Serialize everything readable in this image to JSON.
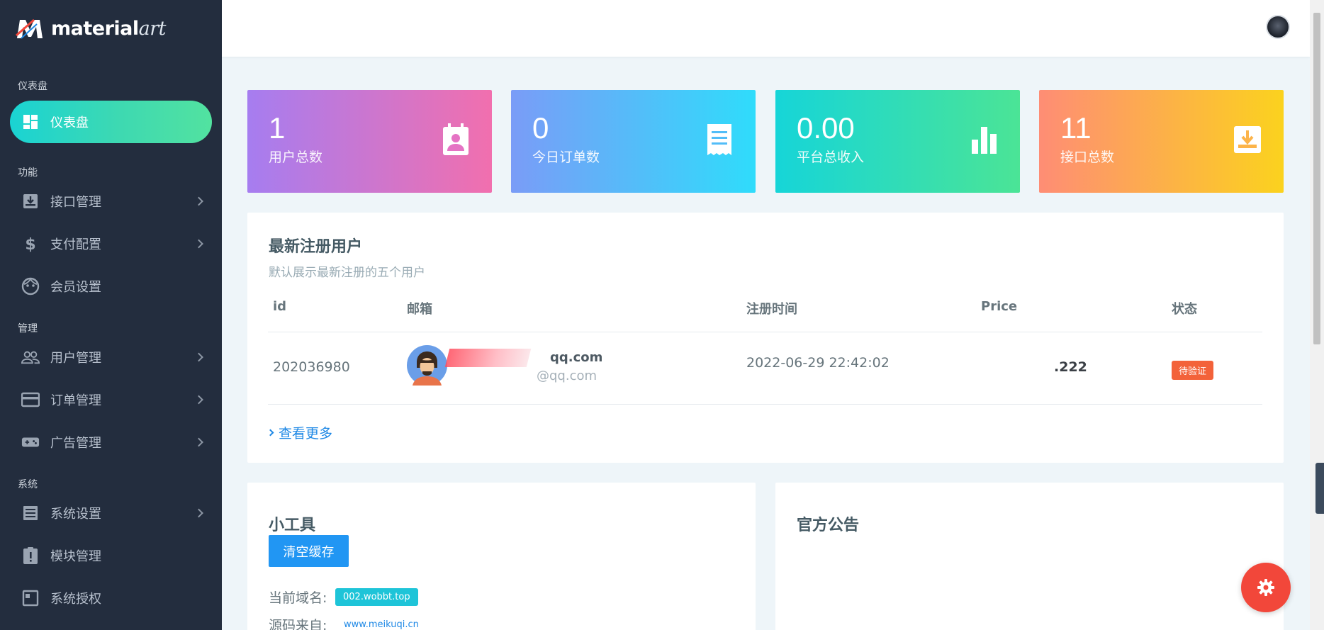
{
  "brand": {
    "name": "material",
    "accent": "art"
  },
  "sidebar": {
    "sections": [
      {
        "label": "仪表盘"
      },
      {
        "label": "功能"
      },
      {
        "label": "管理"
      },
      {
        "label": "系统"
      }
    ],
    "items": [
      {
        "label": "仪表盘",
        "icon": "dashboard-icon",
        "active": true
      },
      {
        "label": "接口管理",
        "icon": "inbox-download-icon"
      },
      {
        "label": "支付配置",
        "icon": "dollar-icon"
      },
      {
        "label": "会员设置",
        "icon": "face-icon"
      },
      {
        "label": "用户管理",
        "icon": "users-icon"
      },
      {
        "label": "订单管理",
        "icon": "credit-card-icon"
      },
      {
        "label": "广告管理",
        "icon": "gamepad-icon"
      },
      {
        "label": "系统设置",
        "icon": "list-icon"
      },
      {
        "label": "模块管理",
        "icon": "clipboard-alert-icon"
      },
      {
        "label": "系统授权",
        "icon": "license-icon"
      }
    ]
  },
  "stats": [
    {
      "value": "1",
      "label": "用户总数",
      "icon": "contact-card-icon"
    },
    {
      "value": "0",
      "label": "今日订单数",
      "icon": "receipt-icon"
    },
    {
      "value": "0.00",
      "label": "平台总收入",
      "icon": "bar-chart-icon"
    },
    {
      "value": "11",
      "label": "接口总数",
      "icon": "inbox-download-icon"
    }
  ],
  "users_card": {
    "title": "最新注册用户",
    "subtitle": "默认展示最新注册的五个用户",
    "columns": [
      "id",
      "邮箱",
      "注册时间",
      "Price",
      "状态"
    ],
    "rows": [
      {
        "id": "202036980",
        "email_primary": "qq.com",
        "email_secondary": "@qq.com",
        "registered": "2022-06-29 22:42:02",
        "price": ".222",
        "status": "待验证"
      }
    ],
    "more": "查看更多"
  },
  "tools_card": {
    "title": "小工具",
    "clear_cache": "清空缓存",
    "domain_label": "当前域名:",
    "domain_value": "002.wobbt.top",
    "source_label": "源码来自:",
    "source_value": "www.meikuqi.cn"
  },
  "notice_card": {
    "title": "官方公告"
  },
  "colors": {
    "sidebar_bg": "#232d3e",
    "active_gradient_start": "#1ad3d3",
    "active_gradient_end": "#52e2a0",
    "link": "#1e88e5",
    "badge": "#f3623a",
    "fab": "#f2473a"
  }
}
